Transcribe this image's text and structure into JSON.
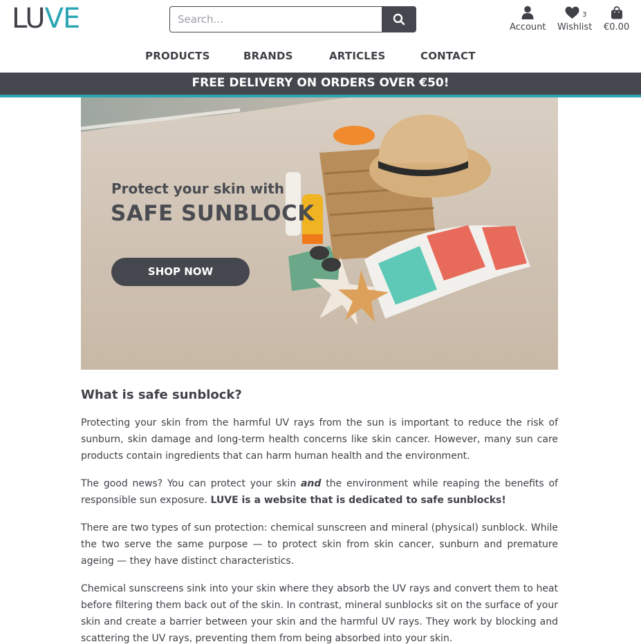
{
  "header": {
    "logo_part1": "LU",
    "logo_part2": "VE",
    "search_placeholder": "Search...",
    "account_label": "Account",
    "wishlist_label": "Wishlist",
    "wishlist_count": "3",
    "cart_label": "€0.00"
  },
  "nav": {
    "items": [
      "PRODUCTS",
      "BRANDS",
      "ARTICLES",
      "CONTACT"
    ]
  },
  "banner": {
    "text": "FREE DELIVERY ON ORDERS OVER €50!"
  },
  "hero": {
    "subtitle": "Protect your skin with",
    "title": "SAFE SUNBLOCK",
    "button": "SHOP NOW"
  },
  "article": {
    "heading": "What is safe sunblock?",
    "p1": "Protecting your skin from the harmful UV rays from the sun is important to reduce the risk of sunburn, skin damage and long-term health concerns like skin cancer. However, many sun care products contain ingredients that can harm human health and the environment.",
    "p2_a": "The good news? You can protect your skin ",
    "p2_em": "and",
    "p2_b": " the environment while reaping the benefits of responsible sun exposure. ",
    "p2_bold": "LUVE is a website that is dedicated to safe sunblocks!",
    "p3": "There are two types of sun protection: chemical sunscreen and mineral (physical) sunblock. While the two serve the same purpose — to protect skin from skin cancer, sunburn and premature ageing — they have distinct characteristics.",
    "p4": "Chemical sunscreens sink into your skin where they absorb the UV rays and convert them to heat before filtering them back out of the skin. In contrast, mineral sunblocks sit on the surface of your skin and create a barrier between your skin and the harmful UV rays. They work by blocking and scattering the UV rays, preventing them from being absorbed into your skin."
  },
  "colors": {
    "dark": "#45474e",
    "accent": "#2aa5b4",
    "text": "#3f4147"
  },
  "icons": {
    "search": "search-icon",
    "account": "user-icon",
    "wishlist": "heart-icon",
    "cart": "shopping-bag-icon"
  }
}
